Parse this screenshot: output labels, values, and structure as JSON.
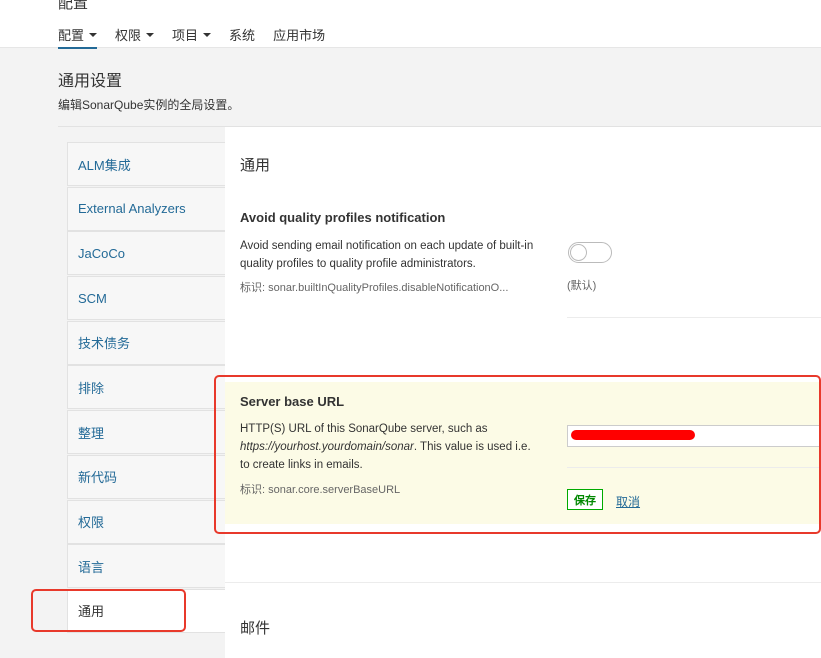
{
  "header": {
    "crumb": "配置",
    "nav": [
      {
        "label": "配置",
        "has_menu": true,
        "active": true
      },
      {
        "label": "权限",
        "has_menu": true
      },
      {
        "label": "项目",
        "has_menu": true
      },
      {
        "label": "系统",
        "has_menu": false
      },
      {
        "label": "应用市场",
        "has_menu": false
      }
    ]
  },
  "page": {
    "title": "通用设置",
    "description": "编辑SonarQube实例的全局设置。"
  },
  "sidebar": {
    "items": [
      {
        "label": "ALM集成"
      },
      {
        "label": "External Analyzers"
      },
      {
        "label": "JaCoCo"
      },
      {
        "label": "SCM"
      },
      {
        "label": "技术债务"
      },
      {
        "label": "排除"
      },
      {
        "label": "整理"
      },
      {
        "label": "新代码"
      },
      {
        "label": "权限"
      },
      {
        "label": "语言"
      },
      {
        "label": "通用",
        "active": true
      }
    ]
  },
  "main": {
    "section_general": "通用",
    "section_email": "邮件",
    "quality_profiles": {
      "name": "Avoid quality profiles notification",
      "description": "Avoid sending email notification on each update of built-in quality profiles to quality profile administrators.",
      "key": "标识: sonar.builtInQualityProfiles.disableNotificationO...",
      "default_label": "(默认)"
    },
    "server_base_url": {
      "name": "Server base URL",
      "desc_before": "HTTP(S) URL of this SonarQube server, such as ",
      "desc_example": "https://yourhost.yourdomain/sonar",
      "desc_after": ". This value is used i.e. to create links in emails.",
      "key": "标识: sonar.core.serverBaseURL",
      "save_label": "保存",
      "cancel_label": "取消"
    }
  },
  "colors": {
    "link": "#236a97",
    "highlight_bg": "#fcfbe6",
    "save_green": "#008800",
    "annotation_red": "#e8392b"
  }
}
